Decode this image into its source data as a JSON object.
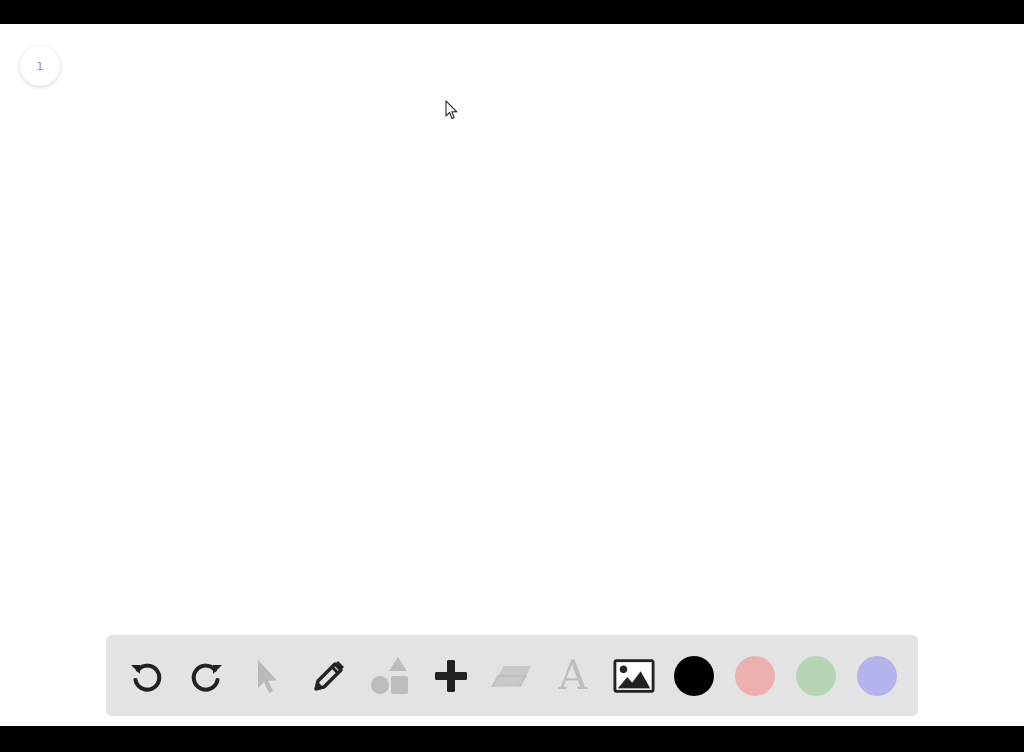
{
  "page": {
    "number": "1"
  },
  "toolbar": {
    "tools": [
      {
        "name": "undo",
        "icon": "undo-icon",
        "enabled": true
      },
      {
        "name": "redo",
        "icon": "redo-icon",
        "enabled": true
      },
      {
        "name": "select",
        "icon": "pointer-icon",
        "enabled": false
      },
      {
        "name": "pen",
        "icon": "pencil-icon",
        "enabled": true
      },
      {
        "name": "shapes",
        "icon": "shapes-icon",
        "enabled": false
      },
      {
        "name": "add",
        "icon": "plus-icon",
        "enabled": true
      },
      {
        "name": "eraser",
        "icon": "eraser-icon",
        "enabled": false
      },
      {
        "name": "text",
        "icon": "text-icon",
        "glyph": "A",
        "enabled": false
      },
      {
        "name": "image",
        "icon": "image-icon",
        "enabled": true
      }
    ],
    "colors": [
      {
        "name": "black",
        "hex": "#000000"
      },
      {
        "name": "red",
        "hex": "#ecb0ae"
      },
      {
        "name": "green",
        "hex": "#b5d6b4"
      },
      {
        "name": "blue",
        "hex": "#b4b4ec"
      }
    ]
  }
}
